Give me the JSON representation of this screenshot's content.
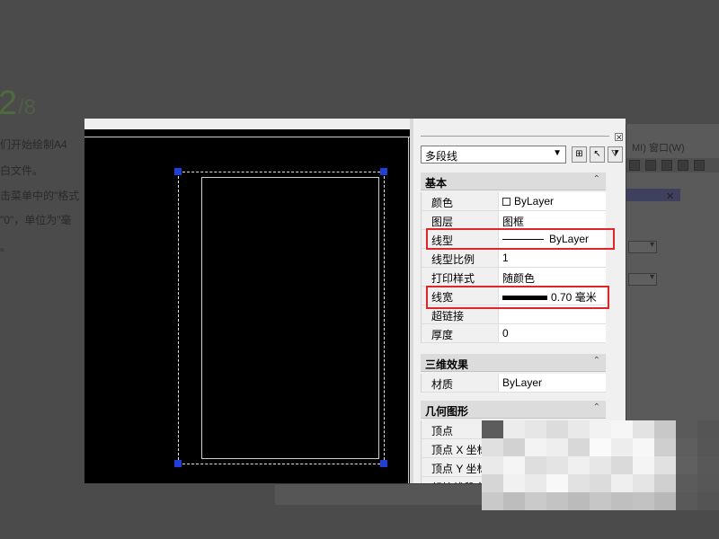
{
  "background_page": {
    "step_number": "2",
    "step_total": "/8",
    "lines": [
      "们开始绘制A4",
      "白文件。",
      "击菜单中的\"格式",
      "\"0\"，单位为\"毫",
      "。"
    ],
    "menu_fragment": "MI)  窗口(W)"
  },
  "palette": {
    "object_type": "多段线",
    "toolbar_icons": [
      "toggle-pickadd-icon",
      "select-objects-icon",
      "quick-select-icon"
    ],
    "sections": [
      {
        "title": "基本",
        "rows": [
          {
            "key": "颜色",
            "value": "ByLayer"
          },
          {
            "key": "图层",
            "value": "图框"
          },
          {
            "key": "线型",
            "value": "ByLayer"
          },
          {
            "key": "线型比例",
            "value": "1"
          },
          {
            "key": "打印样式",
            "value": "随颜色"
          },
          {
            "key": "线宽",
            "value": "0.70 毫米"
          },
          {
            "key": "超链接",
            "value": ""
          },
          {
            "key": "厚度",
            "value": "0"
          }
        ]
      },
      {
        "title": "三维效果",
        "rows": [
          {
            "key": "材质",
            "value": "ByLayer"
          }
        ]
      },
      {
        "title": "几何图形",
        "rows": [
          {
            "key": "顶点",
            "value": ""
          },
          {
            "key": "顶点 X 坐标",
            "value": ""
          },
          {
            "key": "顶点 Y 坐标",
            "value": ""
          },
          {
            "key": "起始线段宽",
            "value": ""
          }
        ]
      }
    ]
  },
  "colors": {
    "highlight": "#e0242b",
    "grip": "#1f3fd6",
    "canvas": "#000000"
  }
}
